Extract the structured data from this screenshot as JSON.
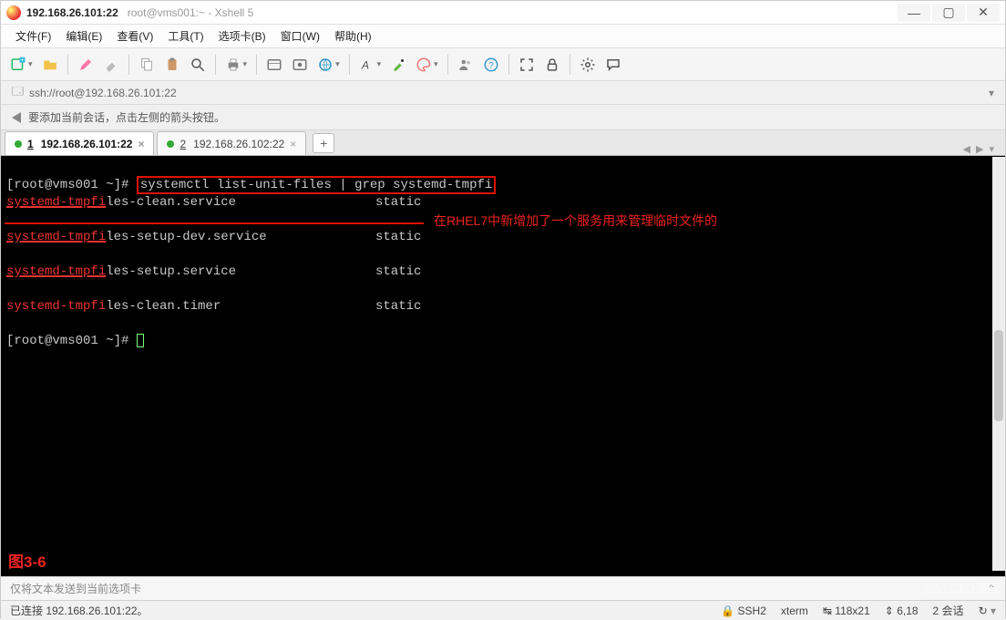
{
  "title": {
    "ip": "192.168.26.101:22",
    "sub": "root@vms001:~ - Xshell 5"
  },
  "winbtns": {
    "min": "—",
    "max": "▢",
    "close": "✕"
  },
  "menu": [
    {
      "label": "文件(F)"
    },
    {
      "label": "编辑(E)"
    },
    {
      "label": "查看(V)"
    },
    {
      "label": "工具(T)"
    },
    {
      "label": "选项卡(B)"
    },
    {
      "label": "窗口(W)"
    },
    {
      "label": "帮助(H)"
    }
  ],
  "toolbar_names": [
    "new-session",
    "open-session",
    "|",
    "pencil",
    "eraser",
    "|",
    "copy",
    "paste",
    "search",
    "|",
    "print",
    "|",
    "properties",
    "tunnel",
    "web",
    "|",
    "font",
    "color-picker",
    "palette",
    "|",
    "users",
    "help",
    "|",
    "fullscreen",
    "lock",
    "|",
    "settings",
    "chat"
  ],
  "location": {
    "protocol": "ssh://root@192.168.26.101:22"
  },
  "infobar": {
    "text": "要添加当前会话，点击左侧的箭头按钮。"
  },
  "tabs": [
    {
      "idx": "1",
      "label": "192.168.26.101:22",
      "active": true
    },
    {
      "idx": "2",
      "label": "192.168.26.102:22",
      "active": false
    }
  ],
  "tab_add": "+",
  "tabnav": {
    "left": "◀",
    "right": "▶",
    "menu": "▾"
  },
  "terminal": {
    "prompt": "[root@vms001 ~]#",
    "command": "systemctl list-unit-files | grep systemd-tmpfi",
    "rows": [
      {
        "pre": "systemd-tmpfi",
        "rest": "les-clean.service",
        "state": "static"
      },
      {
        "pre": "systemd-tmpfi",
        "rest": "les-setup-dev.service",
        "state": "static"
      },
      {
        "pre": "systemd-tmpfi",
        "rest": "les-setup.service",
        "state": "static"
      },
      {
        "pre": "systemd-tmpfi",
        "rest": "les-clean.timer",
        "state": "static"
      }
    ],
    "prompt2": "[root@vms001 ~]#",
    "annotation": "在RHEL7中新增加了一个服务用来管理临时文件的",
    "figure_label": "图3-6"
  },
  "send_strip": "仅将文本发送到当前选项卡",
  "status": {
    "left": "已连接 192.168.26.101:22。",
    "ssh": "SSH2",
    "term": "xterm",
    "size": "118x21",
    "pos": "6,18",
    "sessions": "2 会话"
  },
  "watermark": "©51CTO博客",
  "icons": {
    "lock": "🔒",
    "sizelead": "↹",
    "doclead": "⇤",
    "poslead": "⇕",
    "chatlead": "↻"
  }
}
